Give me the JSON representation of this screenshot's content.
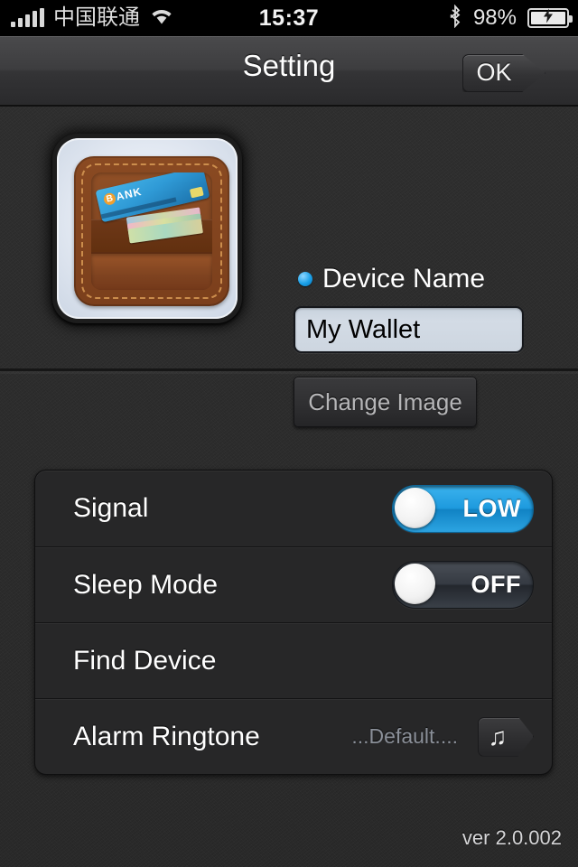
{
  "status_bar": {
    "carrier": "中国联通",
    "time": "15:37",
    "battery_percent": "98%",
    "signal_bars": 5,
    "wifi_icon": "wifi-icon",
    "bluetooth_icon": "bluetooth-icon",
    "battery_icon": "battery-charging-icon"
  },
  "nav": {
    "title": "Setting",
    "ok_label": "OK"
  },
  "device": {
    "image_icon": "wallet-image",
    "bank_card_label": "ANK",
    "bank_card_badge": "B",
    "name_label": "Device Name",
    "name_value": "My Wallet",
    "name_placeholder": "Device Name",
    "change_image_label": "Change Image"
  },
  "settings_rows": [
    {
      "label": "Signal",
      "control": "toggle",
      "state": "on",
      "state_text": "LOW"
    },
    {
      "label": "Sleep Mode",
      "control": "toggle",
      "state": "off",
      "state_text": "OFF"
    },
    {
      "label": "Find Device",
      "control": "none"
    },
    {
      "label": "Alarm Ringtone",
      "control": "ringtone",
      "value": "...Default....",
      "icon": "music-note-icon",
      "icon_glyph": "♫"
    }
  ],
  "footer": {
    "version": "ver 2.0.002"
  },
  "colors": {
    "accent_blue": "#1e9ade",
    "background": "#2c2c2c",
    "panel": "#272728",
    "input_background": "#ced7e1",
    "muted_text": "#8b9099"
  }
}
